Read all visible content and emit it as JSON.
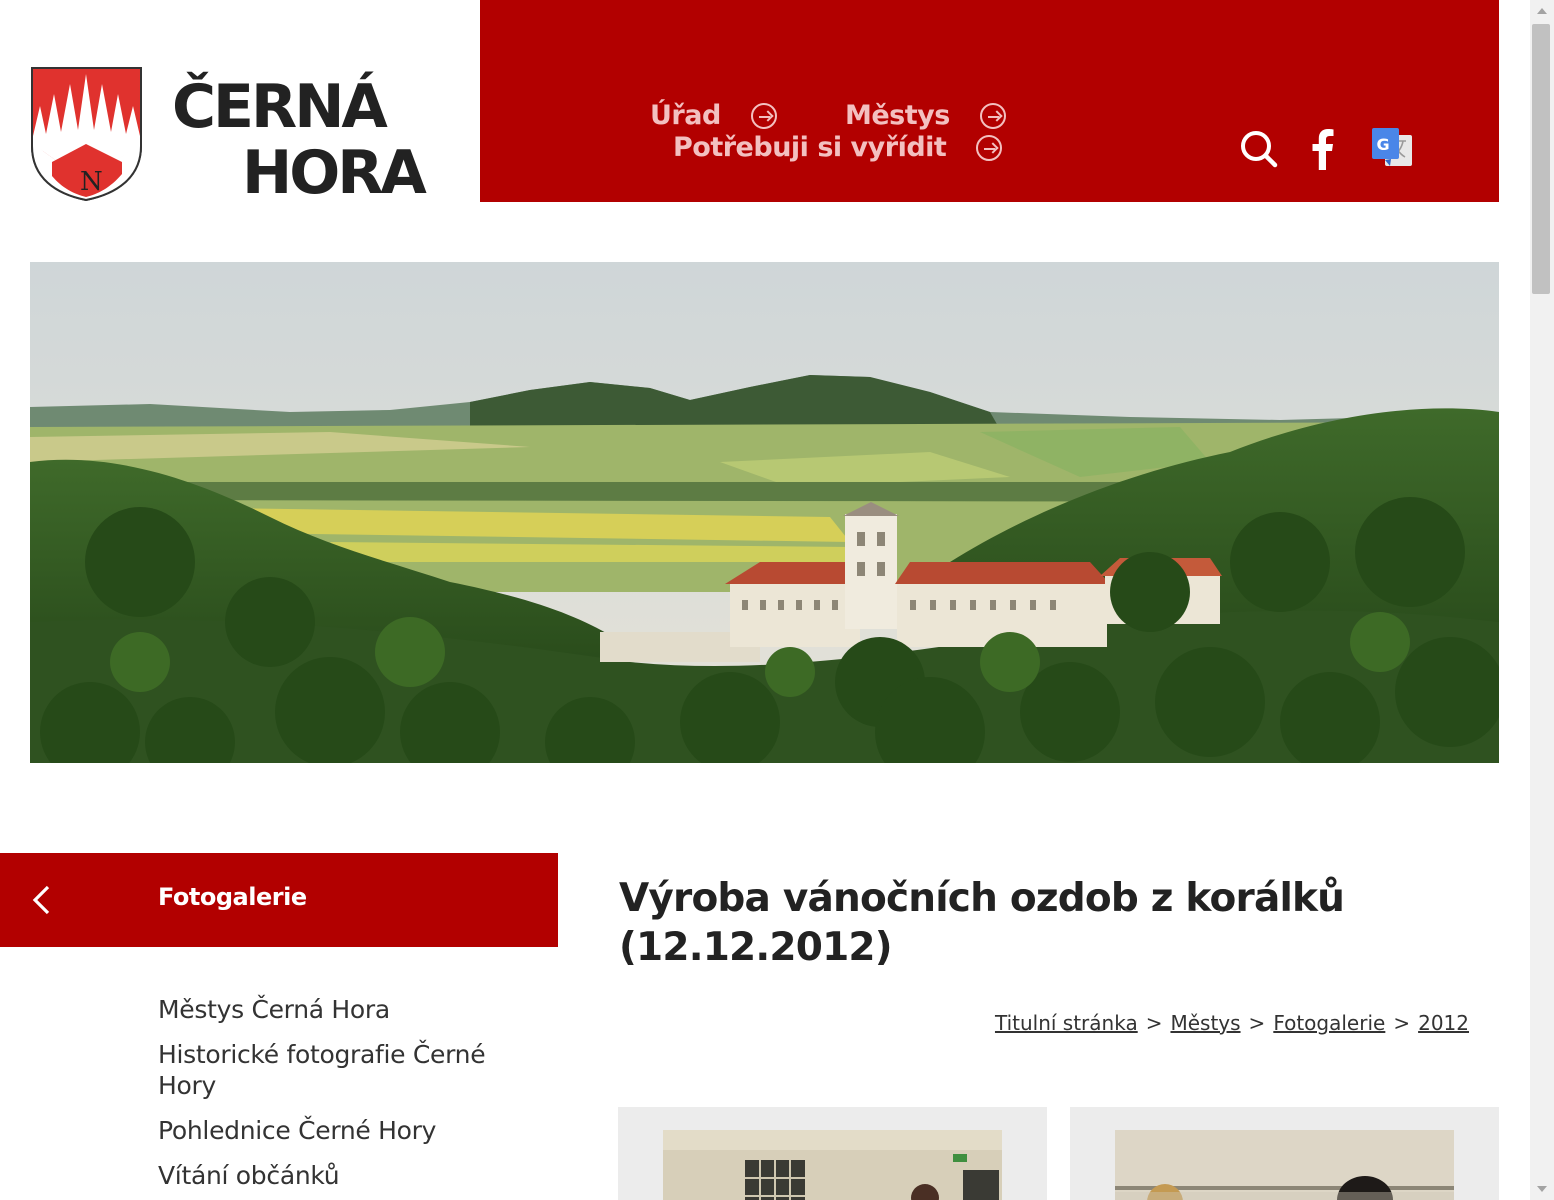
{
  "header": {
    "brand_line1": "ČERNÁ",
    "brand_line2": "HORA",
    "nav": [
      {
        "label": "Úřad"
      },
      {
        "label": "Městys"
      },
      {
        "label": "Potřebuji si vyřídit"
      }
    ],
    "tools": [
      "search-icon",
      "facebook-icon",
      "google-translate-icon"
    ]
  },
  "colors": {
    "brand_red": "#b20000",
    "nav_text": "#f3c0c0"
  },
  "sidebar": {
    "title": "Fotogalerie",
    "items": [
      {
        "label": "Městys Černá Hora"
      },
      {
        "label": "Historické fotografie Černé Hory"
      },
      {
        "label": "Pohlednice Černé Hory"
      },
      {
        "label": "Vítání občánků"
      }
    ]
  },
  "main": {
    "title": "Výroba vánočních ozdob z korálků (12.12.2012)",
    "breadcrumb": [
      {
        "label": "Titulní stránka"
      },
      {
        "label": "Městys"
      },
      {
        "label": "Fotogalerie"
      },
      {
        "label": "2012"
      }
    ],
    "breadcrumb_separator": ">"
  }
}
